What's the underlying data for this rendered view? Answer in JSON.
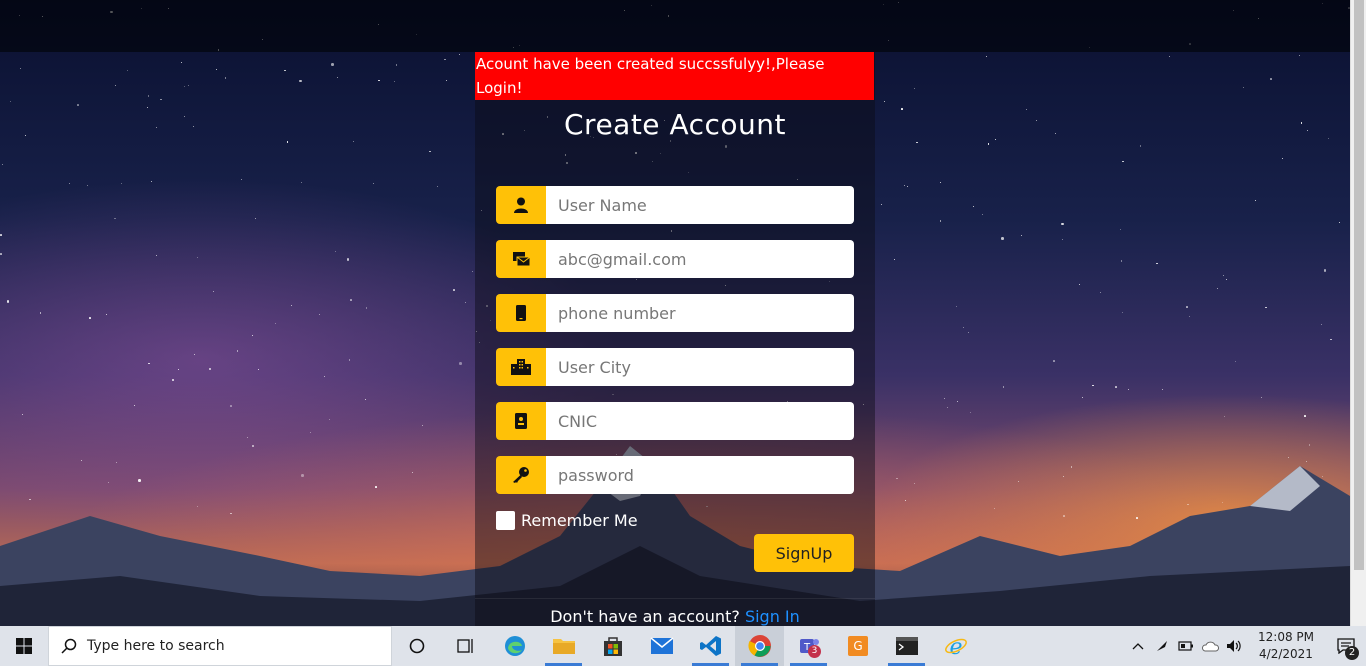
{
  "alert": {
    "message": "Acount have been created succssfulyy!,Please Login!"
  },
  "form": {
    "title": "Create Account",
    "fields": [
      {
        "placeholder": "User Name",
        "icon": "user-icon"
      },
      {
        "placeholder": "abc@gmail.com",
        "icon": "envelope-icon"
      },
      {
        "placeholder": "phone number",
        "icon": "phone-icon"
      },
      {
        "placeholder": "User City",
        "icon": "city-icon"
      },
      {
        "placeholder": "CNIC",
        "icon": "id-card-icon"
      },
      {
        "placeholder": "password",
        "icon": "key-icon"
      }
    ],
    "remember_label": "Remember Me",
    "signup_label": "SignUp",
    "footer_text": "Don't have an account?",
    "signin_link": "Sign In",
    "accent_color": "#ffc107",
    "alert_color": "#ff0000",
    "link_color": "#1e90ff"
  },
  "taskbar": {
    "search_placeholder": "Type here to search",
    "time": "12:08 PM",
    "date": "4/2/2021",
    "notification_count": "2",
    "teams_badge": "3"
  }
}
